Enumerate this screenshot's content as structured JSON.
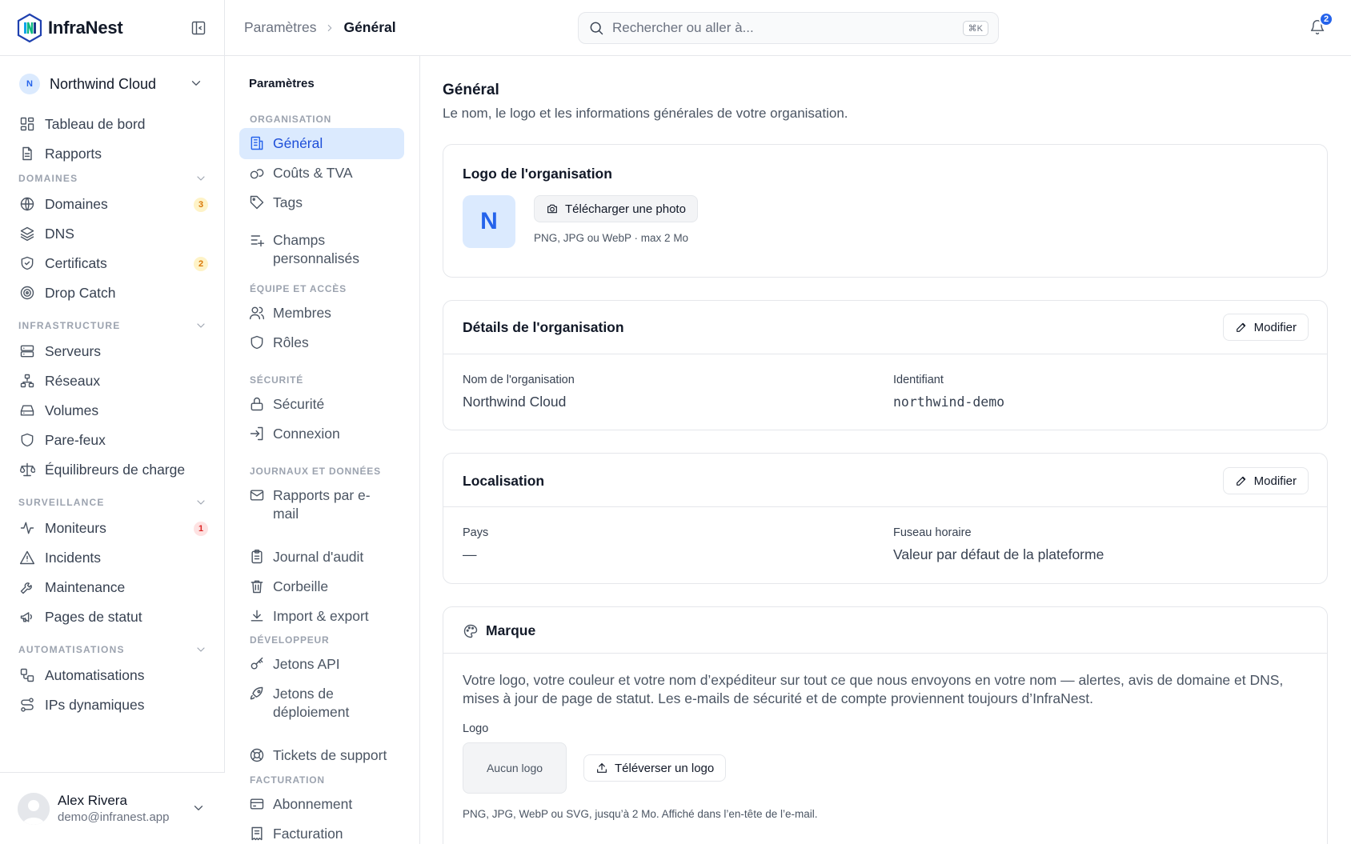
{
  "brand": {
    "name": "InfraNest"
  },
  "org": {
    "initial": "N",
    "name": "Northwind Cloud"
  },
  "sidebar": {
    "top_items": [
      {
        "label": "Tableau de bord",
        "icon": "dashboard-icon"
      },
      {
        "label": "Rapports",
        "icon": "file-text-icon"
      }
    ],
    "sections": [
      {
        "label": "DOMAINES",
        "items": [
          {
            "label": "Domaines",
            "icon": "globe-icon",
            "badge": "3",
            "badge_color": "#d97706"
          },
          {
            "label": "DNS",
            "icon": "layers-icon"
          },
          {
            "label": "Certificats",
            "icon": "shield-check-icon",
            "badge": "2",
            "badge_color": "#d97706"
          },
          {
            "label": "Drop Catch",
            "icon": "target-icon"
          }
        ]
      },
      {
        "label": "INFRASTRUCTURE",
        "items": [
          {
            "label": "Serveurs",
            "icon": "server-icon"
          },
          {
            "label": "Réseaux",
            "icon": "network-icon"
          },
          {
            "label": "Volumes",
            "icon": "hard-drive-icon"
          },
          {
            "label": "Pare-feux",
            "icon": "shield-icon"
          },
          {
            "label": "Équilibreurs de charge",
            "icon": "scale-icon"
          }
        ]
      },
      {
        "label": "SURVEILLANCE",
        "items": [
          {
            "label": "Moniteurs",
            "icon": "activity-icon",
            "badge": "1",
            "badge_color": "#dc2626"
          },
          {
            "label": "Incidents",
            "icon": "alert-triangle-icon"
          },
          {
            "label": "Maintenance",
            "icon": "wrench-icon"
          },
          {
            "label": "Pages de statut",
            "icon": "megaphone-icon"
          }
        ]
      },
      {
        "label": "AUTOMATISATIONS",
        "items": [
          {
            "label": "Automatisations",
            "icon": "workflow-icon"
          },
          {
            "label": "IPs dynamiques",
            "icon": "route-icon"
          }
        ]
      }
    ]
  },
  "user": {
    "name": "Alex Rivera",
    "email": "demo@infranest.app"
  },
  "topbar": {
    "breadcrumb": [
      "Paramètres",
      "Général"
    ],
    "search_placeholder": "Rechercher ou aller à...",
    "search_shortcut": "⌘K",
    "notifications_count": "2"
  },
  "settings_nav": {
    "title": "Paramètres",
    "sections": [
      {
        "label": "ORGANISATION",
        "items": [
          {
            "label": "Général",
            "icon": "building-icon",
            "active": true
          },
          {
            "label": "Coûts & TVA",
            "icon": "coins-icon"
          },
          {
            "label": "Tags",
            "icon": "tag-icon"
          },
          {
            "label": "Champs personnalisés",
            "icon": "list-plus-icon",
            "lines": [
              "Champs",
              "personnalisés"
            ]
          }
        ]
      },
      {
        "label": "ÉQUIPE ET ACCÈS",
        "items": [
          {
            "label": "Membres",
            "icon": "users-icon"
          },
          {
            "label": "Rôles",
            "icon": "shield-icon"
          }
        ]
      },
      {
        "label": "SÉCURITÉ",
        "items": [
          {
            "label": "Sécurité",
            "icon": "lock-icon"
          },
          {
            "label": "Connexion",
            "icon": "log-in-icon"
          }
        ]
      },
      {
        "label": "JOURNAUX ET DONNÉES",
        "items": [
          {
            "label": "Rapports par e-mail",
            "icon": "mail-icon",
            "lines": [
              "Rapports par e-",
              "mail"
            ]
          },
          {
            "label": "Journal d'audit",
            "icon": "clipboard-list-icon"
          },
          {
            "label": "Corbeille",
            "icon": "trash-icon"
          },
          {
            "label": "Import & export",
            "icon": "download-icon"
          }
        ]
      },
      {
        "label": "DÉVELOPPEUR",
        "items": [
          {
            "label": "Jetons API",
            "icon": "key-icon"
          },
          {
            "label": "Jetons de déploiement",
            "icon": "rocket-icon",
            "lines": [
              "Jetons de",
              "déploiement"
            ]
          },
          {
            "label": "Tickets de support",
            "icon": "life-buoy-icon"
          }
        ]
      },
      {
        "label": "FACTURATION",
        "items": [
          {
            "label": "Abonnement",
            "icon": "credit-card-icon"
          },
          {
            "label": "Facturation",
            "icon": "receipt-icon"
          }
        ]
      }
    ]
  },
  "main": {
    "title": "Général",
    "subtitle": "Le nom, le logo et les informations générales de votre organisation.",
    "logo_card": {
      "title": "Logo de l'organisation",
      "initial": "N",
      "upload_label": "Télécharger une photo",
      "hint": "PNG, JPG ou WebP · max 2 Mo"
    },
    "details_card": {
      "title": "Détails de l'organisation",
      "edit_label": "Modifier",
      "name_label": "Nom de l'organisation",
      "name_value": "Northwind Cloud",
      "id_label": "Identifiant",
      "id_value": "northwind-demo"
    },
    "locale_card": {
      "title": "Localisation",
      "edit_label": "Modifier",
      "country_label": "Pays",
      "country_value": "—",
      "tz_label": "Fuseau horaire",
      "tz_value": "Valeur par défaut de la plateforme"
    },
    "brand_card": {
      "title": "Marque",
      "desc_line1": "Votre logo, votre couleur et votre nom d’expéditeur sur tout ce que nous envoyons en votre nom — alertes, avis de domaine et DNS,",
      "desc_line2": "mises à jour de page de statut. Les e-mails de sécurité et de compte proviennent toujours d’InfraNest.",
      "logo_label": "Logo",
      "no_logo": "Aucun logo",
      "upload_logo": "Téléverser un logo",
      "logo_hint": "PNG, JPG, WebP ou SVG, jusqu’à 2 Mo. Affiché dans l’en-tête de l’e-mail."
    }
  },
  "colors": {
    "accent": "#2563eb",
    "active_bg": "#dbeafe",
    "border": "#e5e7eb"
  }
}
